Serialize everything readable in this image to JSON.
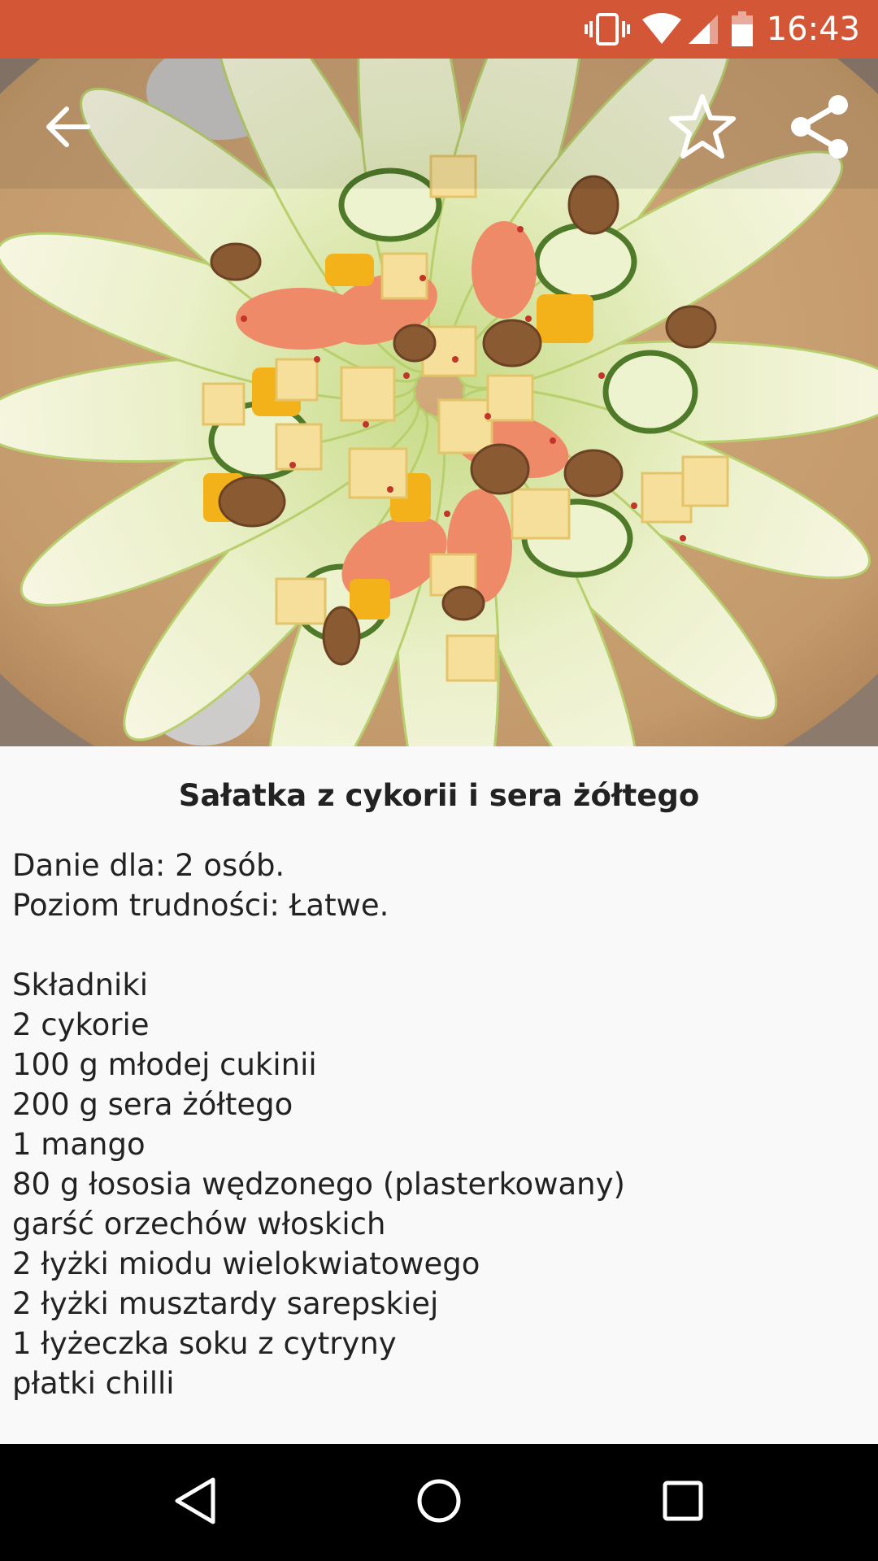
{
  "status_bar": {
    "time": "16:43",
    "icons": [
      "vibrate-icon",
      "wifi-icon",
      "cellular-signal-icon",
      "battery-icon"
    ],
    "background_color": "#d35637"
  },
  "toolbar": {
    "icons": [
      "arrow-back-icon",
      "star-outline-icon",
      "share-icon"
    ]
  },
  "recipe": {
    "title": "Sałatka z cykorii i sera żółtego",
    "servings": "Danie dla: 2 osób.",
    "difficulty": "Poziom trudności: Łatwe.",
    "ingredients_heading": "Składniki",
    "ingredients": [
      "2 cykorie",
      "100 g młodej cukinii",
      "200 g sera żółtego",
      "1 mango",
      "80 g łososia wędzonego (plasterkowany)",
      "garść orzechów włoskich",
      "2 łyżki miodu wielokwiatowego",
      "2 łyżki musztardy sarepskiej",
      "1 łyżeczka soku z cytryny",
      "płatki chilli"
    ]
  },
  "nav_bar": {
    "icons": [
      "nav-back-icon",
      "nav-home-icon",
      "nav-recents-icon"
    ]
  }
}
